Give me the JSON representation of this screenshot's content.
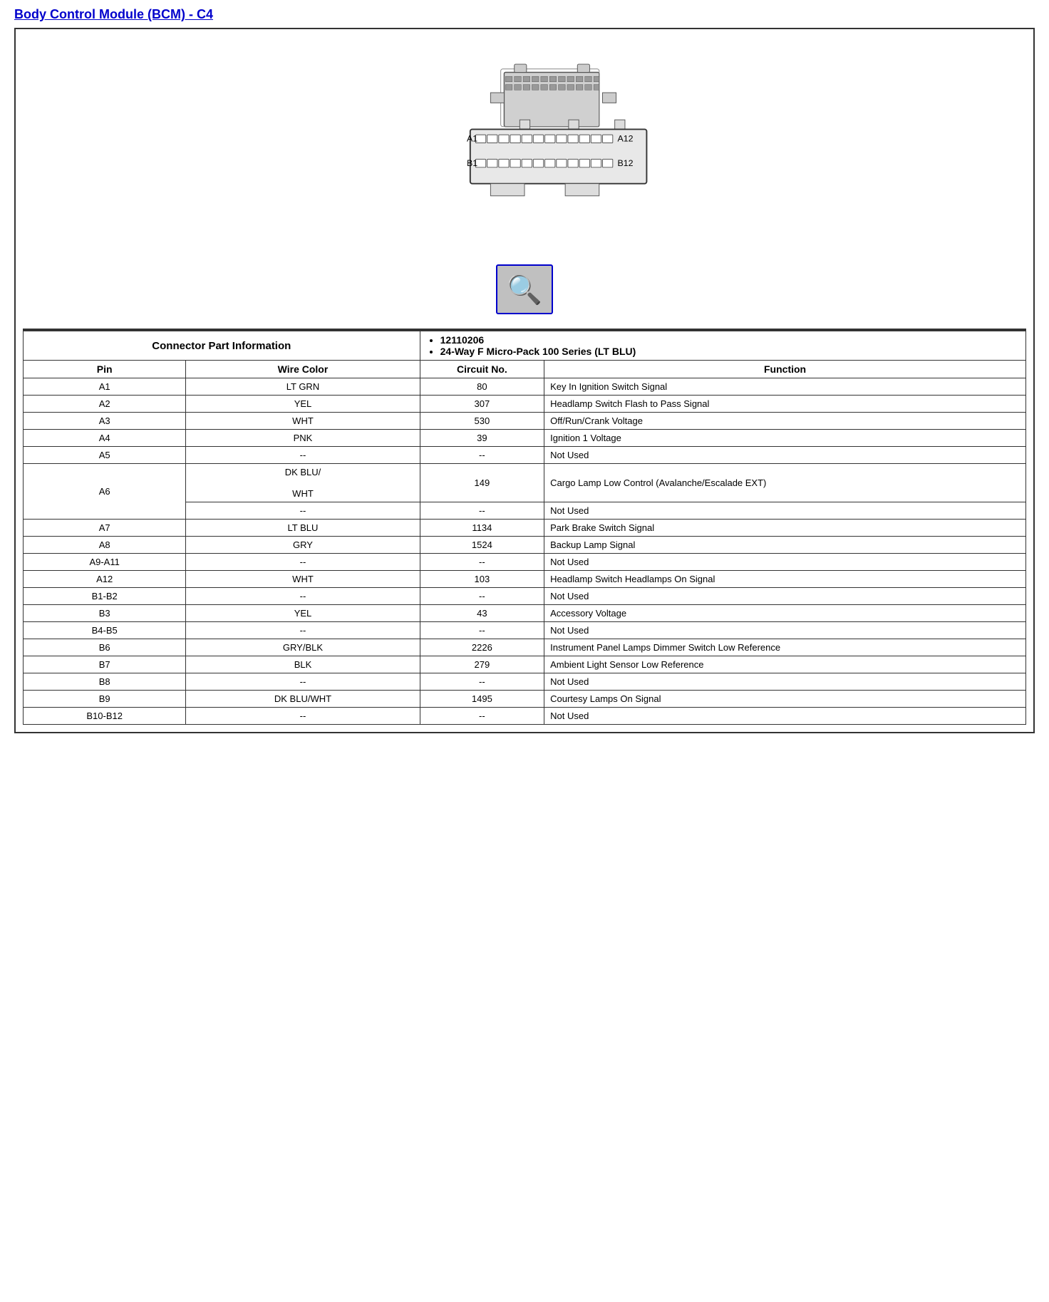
{
  "title": "Body Control Module (BCM) - C4",
  "connector_info": {
    "label": "Connector Part Information",
    "part_number": "12110206",
    "description": "24-Way F Micro-Pack 100 Series (LT BLU)"
  },
  "table_headers": {
    "pin": "Pin",
    "wire_color": "Wire Color",
    "circuit_no": "Circuit No.",
    "function": "Function"
  },
  "rows": [
    {
      "pin": "A1",
      "wire_color": "LT GRN",
      "circuit_no": "80",
      "function": "Key In Ignition Switch Signal"
    },
    {
      "pin": "A2",
      "wire_color": "YEL",
      "circuit_no": "307",
      "function": "Headlamp Switch Flash to Pass Signal"
    },
    {
      "pin": "A3",
      "wire_color": "WHT",
      "circuit_no": "530",
      "function": "Off/Run/Crank Voltage"
    },
    {
      "pin": "A4",
      "wire_color": "PNK",
      "circuit_no": "39",
      "function": "Ignition 1 Voltage"
    },
    {
      "pin": "A5",
      "wire_color": "--",
      "circuit_no": "--",
      "function": "Not Used"
    },
    {
      "pin": "A6",
      "wire_color": "DK BLU/\n\nWHT",
      "circuit_no": "149",
      "function": "Cargo Lamp Low Control (Avalanche/Escalade EXT)",
      "extra_row": true,
      "extra_wire": "--",
      "extra_circuit": "--",
      "extra_function": "Not Used"
    },
    {
      "pin": "A7",
      "wire_color": "LT BLU",
      "circuit_no": "1134",
      "function": "Park Brake Switch Signal"
    },
    {
      "pin": "A8",
      "wire_color": "GRY",
      "circuit_no": "1524",
      "function": "Backup Lamp Signal"
    },
    {
      "pin": "A9-A11",
      "wire_color": "--",
      "circuit_no": "--",
      "function": "Not Used"
    },
    {
      "pin": "A12",
      "wire_color": "WHT",
      "circuit_no": "103",
      "function": "Headlamp Switch Headlamps On Signal"
    },
    {
      "pin": "B1-B2",
      "wire_color": "--",
      "circuit_no": "--",
      "function": "Not Used"
    },
    {
      "pin": "B3",
      "wire_color": "YEL",
      "circuit_no": "43",
      "function": "Accessory Voltage"
    },
    {
      "pin": "B4-B5",
      "wire_color": "--",
      "circuit_no": "--",
      "function": "Not Used"
    },
    {
      "pin": "B6",
      "wire_color": "GRY/BLK",
      "circuit_no": "2226",
      "function": "Instrument Panel Lamps Dimmer Switch Low Reference"
    },
    {
      "pin": "B7",
      "wire_color": "BLK",
      "circuit_no": "279",
      "function": "Ambient Light Sensor Low Reference"
    },
    {
      "pin": "B8",
      "wire_color": "--",
      "circuit_no": "--",
      "function": "Not Used"
    },
    {
      "pin": "B9",
      "wire_color": "DK BLU/WHT",
      "circuit_no": "1495",
      "function": "Courtesy Lamps On Signal"
    },
    {
      "pin": "B10-B12",
      "wire_color": "--",
      "circuit_no": "--",
      "function": "Not Used"
    }
  ]
}
